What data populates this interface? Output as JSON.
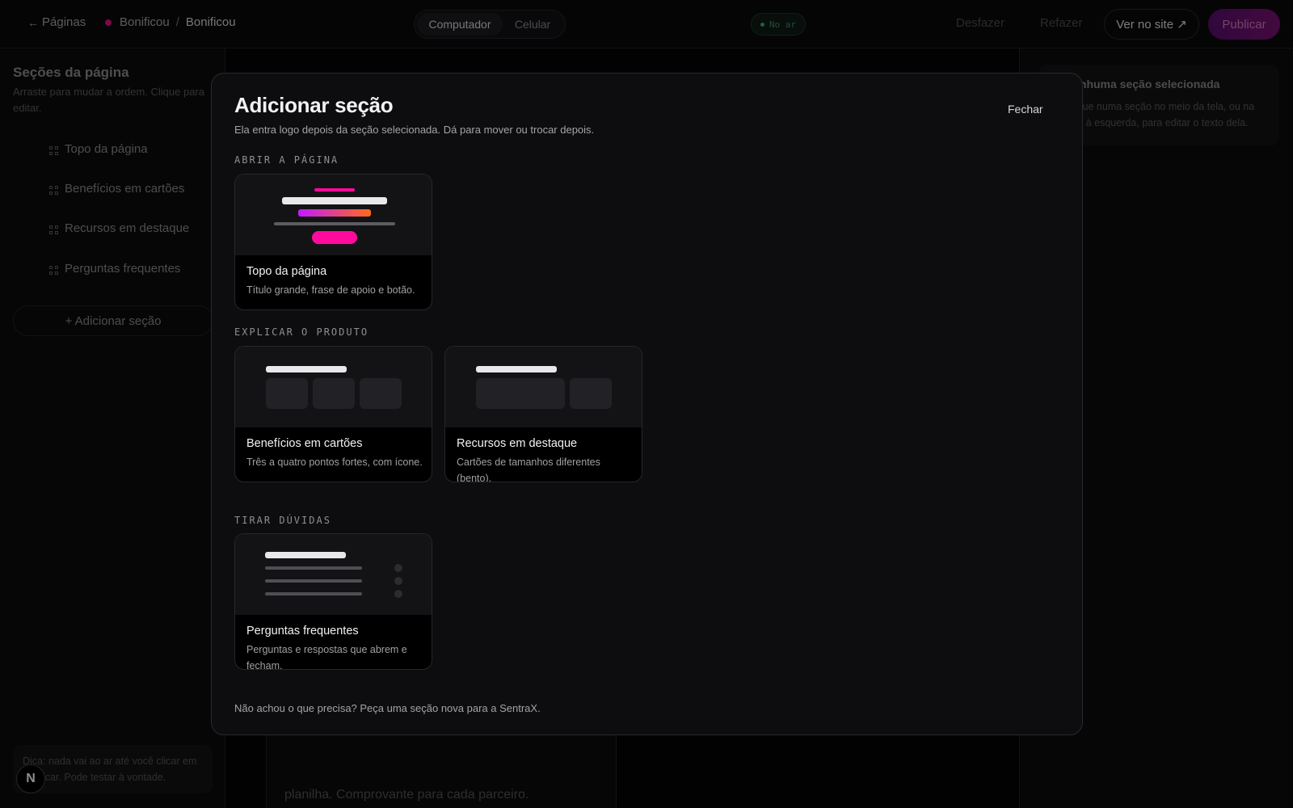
{
  "topbar": {
    "back_label": "Páginas",
    "site_name": "Bonificou",
    "separator": "/",
    "page_name": "Bonificou",
    "devices": [
      "Computador",
      "Celular"
    ],
    "status": "No ar",
    "undo": "Desfazer",
    "redo": "Refazer",
    "view_site": "Ver no site ↗",
    "publish": "Publicar",
    "colors": {
      "brand_dot": "#e0147f",
      "status_green": "#2dbb6b"
    }
  },
  "sidebar": {
    "title": "Seções da página",
    "subtitle": "Arraste para mudar a ordem. Clique para editar.",
    "items": [
      {
        "label": "Topo da página",
        "icon": "grid-icon"
      },
      {
        "label": "Benefícios em cartões",
        "icon": "grid-icon"
      },
      {
        "label": "Recursos em destaque",
        "icon": "grid-icon"
      },
      {
        "label": "Perguntas frequentes",
        "icon": "grid-icon"
      }
    ],
    "add_button": "+ Adicionar seção",
    "tip": "Dica: nada vai ao ar até você clicar em Publicar. Pode testar à vontade.",
    "logo_letter": "N"
  },
  "canvas": {
    "card_text": "planilha. Comprovante para cada parceiro."
  },
  "right_panel": {
    "title": "Nenhuma seção selecionada",
    "text": "Clique numa seção no meio da tela, ou na lista à esquerda, para editar o texto dela."
  },
  "modal": {
    "title": "Adicionar seção",
    "subtitle": "Ela entra logo depois da seção selecionada. Dá para mover ou trocar depois.",
    "close": "Fechar",
    "groups": [
      {
        "label": "ABRIR A PÁGINA",
        "cards": [
          {
            "name": "Topo da página",
            "desc": "Título grande, frase de apoio e botão."
          }
        ]
      },
      {
        "label": "EXPLICAR O PRODUTO",
        "cards": [
          {
            "name": "Benefícios em cartões",
            "desc": "Três a quatro pontos fortes, com ícone."
          },
          {
            "name": "Recursos em destaque",
            "desc": "Cartões de tamanhos diferentes (bento)."
          }
        ]
      },
      {
        "label": "TIRAR DÚVIDAS",
        "cards": [
          {
            "name": "Perguntas frequentes",
            "desc": "Perguntas e respostas que abrem e fecham."
          }
        ]
      }
    ],
    "footer": "Não achou o que precisa? Peça uma seção nova para a SentraX.",
    "colors": {
      "accent_pink": "#ff0a9c",
      "gradient_from": "#c21bff",
      "gradient_to": "#ff6a1a"
    }
  }
}
